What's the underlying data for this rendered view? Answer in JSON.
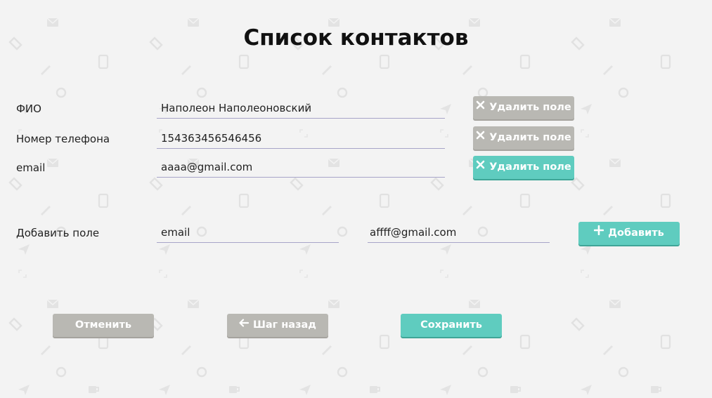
{
  "page": {
    "title": "Список контактов"
  },
  "fields": [
    {
      "label": "ФИО",
      "value": "Наполеон Наполеоновский",
      "delete_label": "Удалить поле"
    },
    {
      "label": "Номер телефона",
      "value": "154363456546456",
      "delete_label": "Удалить поле"
    },
    {
      "label": "email",
      "value": "aaaa@gmail.com",
      "delete_label": "Удалить поле"
    }
  ],
  "add_field": {
    "label": "Добавить поле",
    "name_value": "email",
    "value_value": "affff@gmail.com",
    "add_label": "Добавить"
  },
  "actions": {
    "cancel_label": "Отменить",
    "back_label": "Шаг назад",
    "save_label": "Сохранить"
  },
  "colors": {
    "accent": "#5fccbf",
    "neutral_button": "#b9b8b3",
    "background": "#f3f3f3",
    "underline": "#a7a4c8"
  }
}
